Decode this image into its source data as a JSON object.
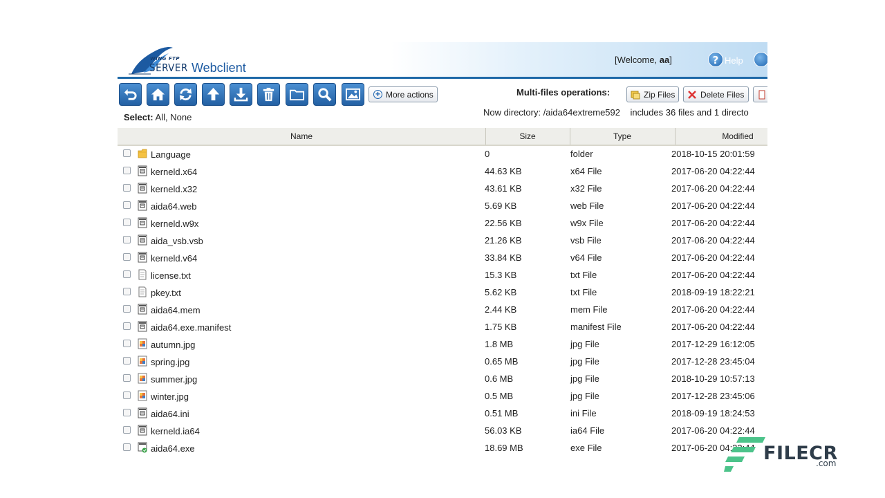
{
  "header": {
    "brand_small": "WING FTP",
    "brand_server": "SERVER",
    "app_title": "Webclient",
    "welcome_prefix": "[Welcome, ",
    "welcome_user": "aa",
    "welcome_suffix": "]",
    "help_label": "Help"
  },
  "toolbar": {
    "buttons": [
      "back-icon",
      "home-icon",
      "refresh-icon",
      "upload-icon",
      "download-icon",
      "delete-icon",
      "new-folder-icon",
      "search-icon",
      "image-view-icon"
    ],
    "more_actions_label": "More actions",
    "multi_label": "Multi-files operations:",
    "zip_label": "Zip Files",
    "delete_label": "Delete Files"
  },
  "selection": {
    "label": "Select:",
    "all": "All",
    "sep": ", ",
    "none": "None"
  },
  "directory": {
    "text": "Now directory: /aida64extreme592",
    "includes": "includes 36 files and 1 directo"
  },
  "table": {
    "columns": {
      "name": "Name",
      "size": "Size",
      "type": "Type",
      "modified": "Modified"
    },
    "rows": [
      {
        "icon": "folder-icon",
        "name": "Language",
        "size": "0",
        "type": "folder",
        "modified": "2018-10-15 20:01:59"
      },
      {
        "icon": "file-icon",
        "name": "kerneld.x64",
        "size": "44.63 KB",
        "type": " x64 File",
        "modified": "2017-06-20 04:22:44"
      },
      {
        "icon": "file-icon",
        "name": "kerneld.x32",
        "size": "43.61 KB",
        "type": " x32 File",
        "modified": "2017-06-20 04:22:44"
      },
      {
        "icon": "file-icon",
        "name": "aida64.web",
        "size": "5.69 KB",
        "type": " web File",
        "modified": "2017-06-20 04:22:44"
      },
      {
        "icon": "file-icon",
        "name": "kerneld.w9x",
        "size": "22.56 KB",
        "type": " w9x File",
        "modified": "2017-06-20 04:22:44"
      },
      {
        "icon": "file-icon",
        "name": "aida_vsb.vsb",
        "size": "21.26 KB",
        "type": " vsb File",
        "modified": "2017-06-20 04:22:44"
      },
      {
        "icon": "file-icon",
        "name": "kerneld.v64",
        "size": "33.84 KB",
        "type": " v64 File",
        "modified": "2017-06-20 04:22:44"
      },
      {
        "icon": "text-file-icon",
        "name": "license.txt",
        "size": "15.3 KB",
        "type": " txt File",
        "modified": "2017-06-20 04:22:44"
      },
      {
        "icon": "text-file-icon",
        "name": "pkey.txt",
        "size": "5.62 KB",
        "type": " txt File",
        "modified": "2018-09-19 18:22:21"
      },
      {
        "icon": "file-icon",
        "name": "aida64.mem",
        "size": "2.44 KB",
        "type": " mem File",
        "modified": "2017-06-20 04:22:44"
      },
      {
        "icon": "file-icon",
        "name": "aida64.exe.manifest",
        "size": "1.75 KB",
        "type": " manifest File",
        "modified": "2017-06-20 04:22:44"
      },
      {
        "icon": "image-file-icon",
        "name": "autumn.jpg",
        "size": "1.8 MB",
        "type": " jpg File",
        "modified": "2017-12-29 16:12:05"
      },
      {
        "icon": "image-file-icon",
        "name": "spring.jpg",
        "size": "0.65 MB",
        "type": " jpg File",
        "modified": "2017-12-28 23:45:04"
      },
      {
        "icon": "image-file-icon",
        "name": "summer.jpg",
        "size": "0.6 MB",
        "type": " jpg File",
        "modified": "2018-10-29 10:57:13"
      },
      {
        "icon": "image-file-icon",
        "name": "winter.jpg",
        "size": "0.5 MB",
        "type": " jpg File",
        "modified": "2017-12-28 23:45:06"
      },
      {
        "icon": "file-icon",
        "name": "aida64.ini",
        "size": "0.51 MB",
        "type": " ini File",
        "modified": "2018-09-19 18:24:53"
      },
      {
        "icon": "file-icon",
        "name": "kerneld.ia64",
        "size": "56.03 KB",
        "type": " ia64 File",
        "modified": "2017-06-20 04:22:44"
      },
      {
        "icon": "exe-file-icon",
        "name": "aida64.exe",
        "size": "18.69 MB",
        "type": " exe File",
        "modified": "2017-06-20 04:22:44"
      }
    ]
  },
  "watermark": {
    "text": "FILECR",
    "domain": ".com"
  },
  "colors": {
    "header_blue": "#1f69a8",
    "button_blue": "#2360a3",
    "header_bg": "#eeeeea"
  }
}
